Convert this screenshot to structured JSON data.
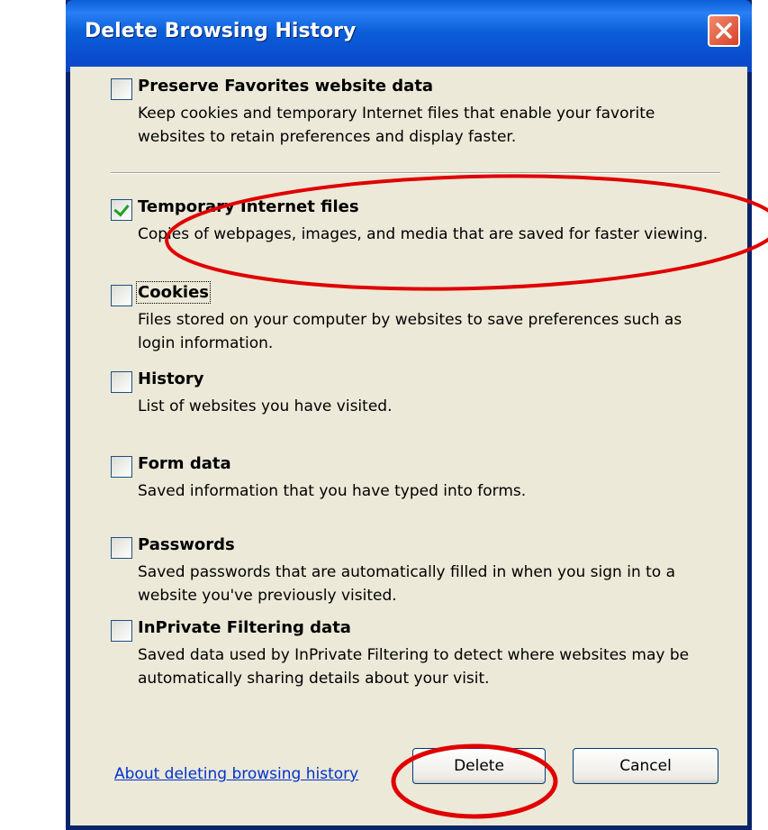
{
  "dialog": {
    "title": "Delete Browsing History",
    "close_icon": "close-icon"
  },
  "options": [
    {
      "label": "Preserve Favorites website data",
      "description": "Keep cookies and temporary Internet files that enable your favorite websites to retain preferences and display faster.",
      "checked": false
    },
    {
      "label": "Temporary Internet files",
      "description": "Copies of webpages, images, and media that are saved for faster viewing.",
      "checked": true
    },
    {
      "label": "Cookies",
      "description": "Files stored on your computer by websites to save preferences such as login information.",
      "checked": false
    },
    {
      "label": "History",
      "description": "List of websites you have visited.",
      "checked": false
    },
    {
      "label": "Form data",
      "description": "Saved information that you have typed into forms.",
      "checked": false
    },
    {
      "label": "Passwords",
      "description": "Saved passwords that are automatically filled in when you sign in to a website you've previously visited.",
      "checked": false
    },
    {
      "label": "InPrivate Filtering data",
      "description": "Saved data used by InPrivate Filtering to detect where websites may be automatically sharing details about your visit.",
      "checked": false
    }
  ],
  "footer": {
    "link": "About deleting browsing history",
    "delete_label": "Delete",
    "cancel_label": "Cancel"
  },
  "annotation": {
    "color": "#e00000"
  }
}
